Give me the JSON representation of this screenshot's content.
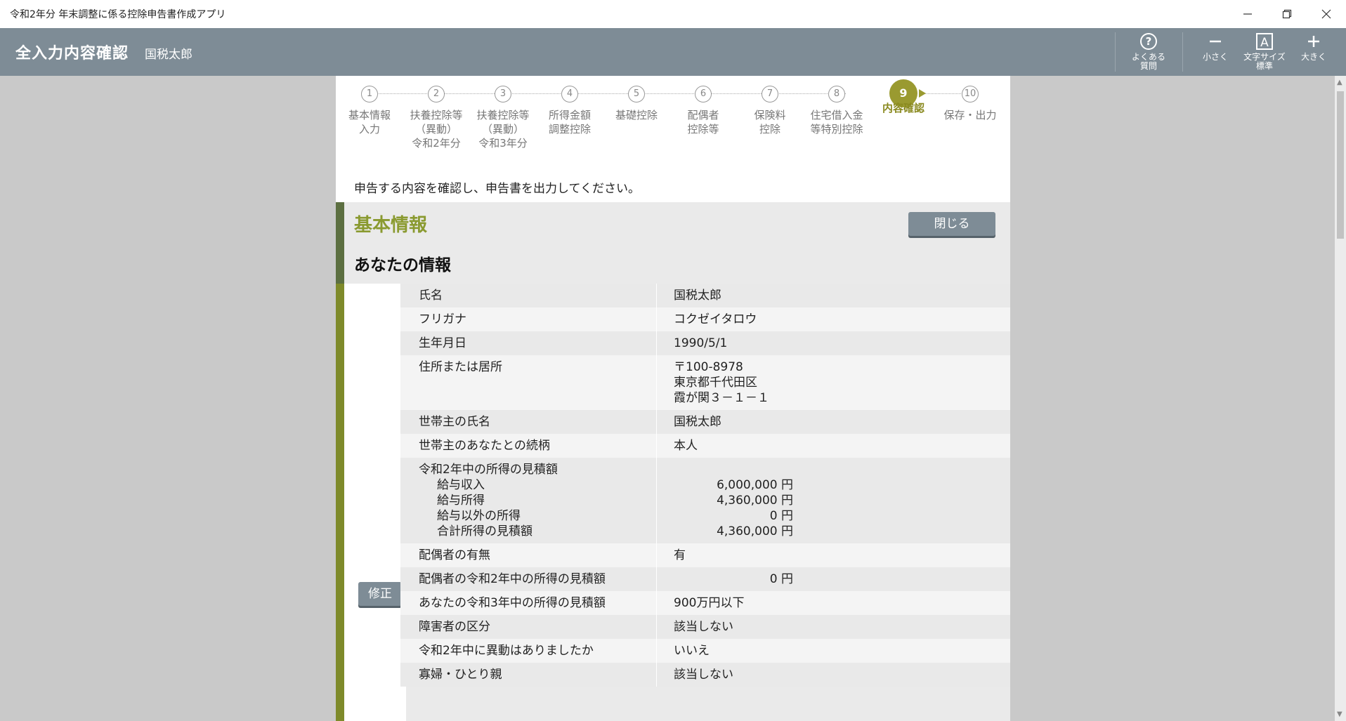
{
  "window": {
    "title": "令和2年分 年末調整に係る控除申告書作成アプリ"
  },
  "header": {
    "screen_title": "全入力内容確認",
    "user_name": "国税太郎",
    "tools": {
      "faq": "よくある\n質問",
      "smaller": "小さく",
      "font_size": "文字サイズ\n標準",
      "larger": "大きく"
    }
  },
  "steps": [
    {
      "num": "1",
      "label": "基本情報\n入力"
    },
    {
      "num": "2",
      "label": "扶養控除等\n（異動）\n令和2年分"
    },
    {
      "num": "3",
      "label": "扶養控除等\n（異動）\n令和3年分"
    },
    {
      "num": "4",
      "label": "所得金額\n調整控除"
    },
    {
      "num": "5",
      "label": "基礎控除"
    },
    {
      "num": "6",
      "label": "配偶者\n控除等"
    },
    {
      "num": "7",
      "label": "保険料\n控除"
    },
    {
      "num": "8",
      "label": "住宅借入金\n等特別控除"
    },
    {
      "num": "9",
      "label": "内容確認"
    },
    {
      "num": "10",
      "label": "保存・出力"
    }
  ],
  "active_step": 9,
  "instruction": "申告する内容を確認し、申告書を出力してください。",
  "section": {
    "title": "基本情報",
    "close_label": "閉じる",
    "subtitle": "あなたの情報",
    "fix_label": "修正"
  },
  "rows": {
    "name": {
      "label": "氏名",
      "value": "国税太郎"
    },
    "kana": {
      "label": "フリガナ",
      "value": "コクゼイタロウ"
    },
    "birth": {
      "label": "生年月日",
      "value": "1990/5/1"
    },
    "address": {
      "label": "住所または居所",
      "postal": "〒100-8978",
      "line1": "東京都千代田区",
      "line2": "霞が関３－１－１"
    },
    "head_name": {
      "label": "世帯主の氏名",
      "value": "国税太郎"
    },
    "head_relation": {
      "label": "世帯主のあなたとの続柄",
      "value": "本人"
    },
    "income": {
      "label": "令和2年中の所得の見積額",
      "salary_income_label": "給与収入",
      "salary_income": "6,000,000 円",
      "salary_profit_label": "給与所得",
      "salary_profit": "4,360,000 円",
      "other_label": "給与以外の所得",
      "other": "0 円",
      "total_label": "合計所得の見積額",
      "total": "4,360,000 円"
    },
    "spouse": {
      "label": "配偶者の有無",
      "value": "有"
    },
    "spouse_income": {
      "label": "配偶者の令和2年中の所得の見積額",
      "value": "0 円"
    },
    "your_income_r3": {
      "label": "あなたの令和3年中の所得の見積額",
      "value": "900万円以下"
    },
    "disability": {
      "label": "障害者の区分",
      "value": "該当しない"
    },
    "change": {
      "label": "令和2年中に異動はありましたか",
      "value": "いいえ"
    },
    "widow": {
      "label": "寡婦・ひとり親",
      "value": "該当しない"
    }
  }
}
